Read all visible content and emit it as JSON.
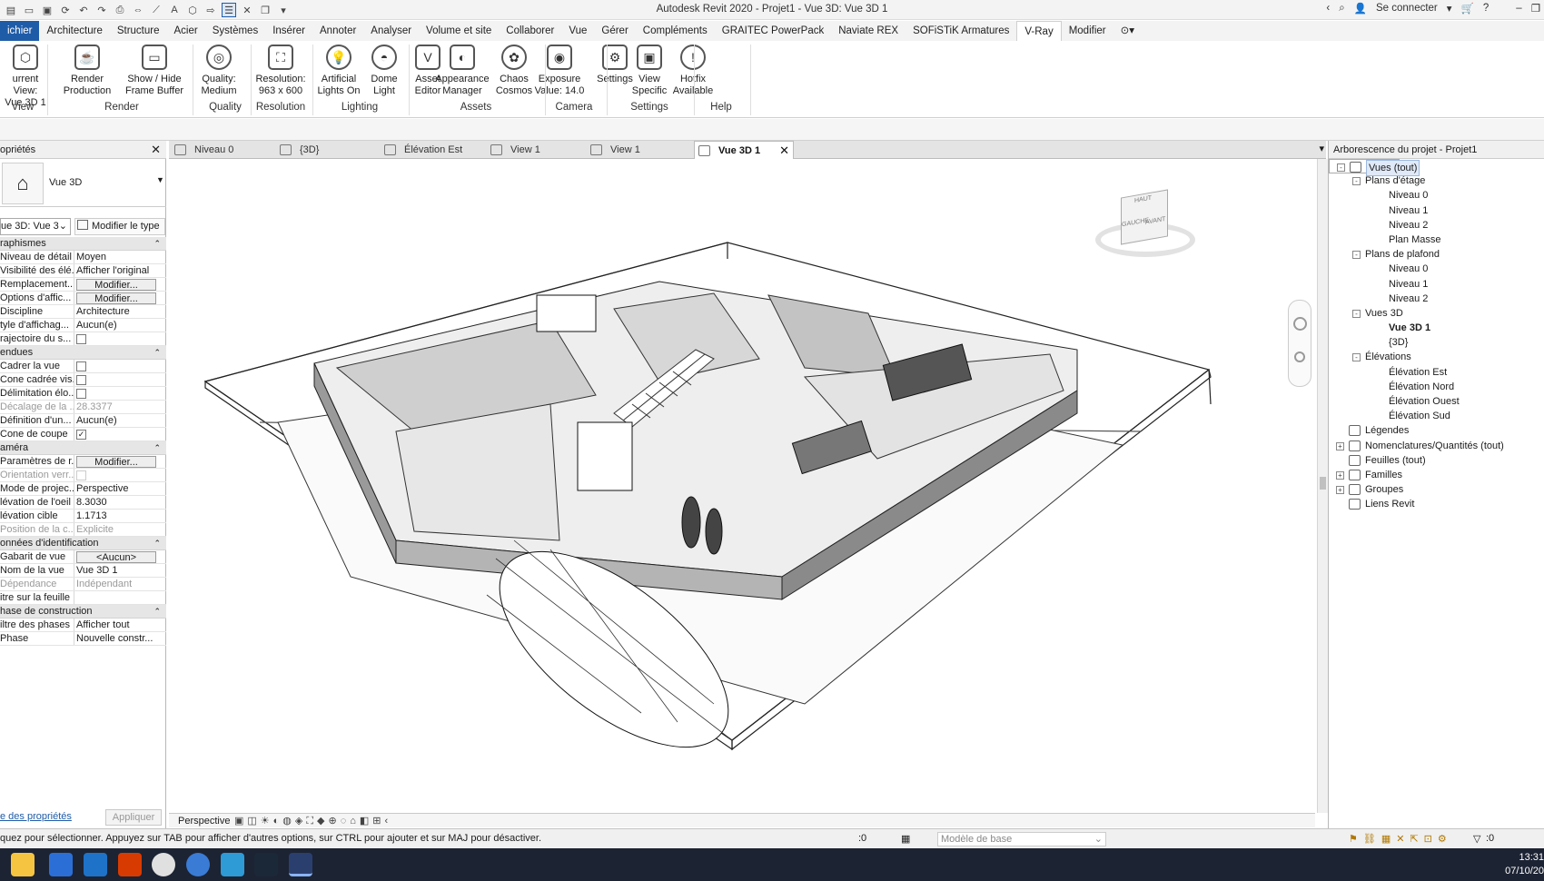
{
  "window": {
    "title": "Autodesk Revit 2020 - Projet1 - Vue 3D: Vue 3D 1",
    "sign_in": "Se connecter"
  },
  "ribbon_tabs": [
    "ichier",
    "Architecture",
    "Structure",
    "Acier",
    "Systèmes",
    "Insérer",
    "Annoter",
    "Analyser",
    "Volume et site",
    "Collaborer",
    "Vue",
    "Gérer",
    "Compléments",
    "GRAITEC PowerPack",
    "Naviate REX",
    "SOFiSTiK Armatures",
    "V-Ray",
    "Modifier"
  ],
  "active_tab": "V-Ray",
  "ribbon": {
    "buttons": [
      {
        "label1": "urrent View:",
        "label2": "Vue 3D 1",
        "icon": "cube-icon"
      },
      {
        "label1": "Render",
        "label2": "Production",
        "icon": "teapot-icon"
      },
      {
        "label1": "Show / Hide",
        "label2": "Frame Buffer",
        "icon": "frame-buffer-icon"
      },
      {
        "label1": "Quality:",
        "label2": "Medium",
        "icon": "quality-icon"
      },
      {
        "label1": "Resolution:",
        "label2": "963 x 600",
        "icon": "resolution-icon"
      },
      {
        "label1": "Artificial",
        "label2": "Lights On",
        "icon": "bulb-icon"
      },
      {
        "label1": "Dome",
        "label2": "Light",
        "icon": "dome-icon"
      },
      {
        "label1": "Asset",
        "label2": "Editor",
        "icon": "vray-icon"
      },
      {
        "label1": "Appearance",
        "label2": "Manager",
        "icon": "appearance-icon"
      },
      {
        "label1": "Chaos",
        "label2": "Cosmos",
        "icon": "cosmos-icon"
      },
      {
        "label1": "Exposure",
        "label2": "Value: 14.0",
        "icon": "camera-icon"
      },
      {
        "label1": "Settings",
        "label2": "",
        "icon": "gear-icon"
      },
      {
        "label1": "View",
        "label2": "Specific",
        "icon": "view-specific-icon"
      },
      {
        "label1": "Hotfix",
        "label2": "Available",
        "icon": "alert-icon"
      }
    ],
    "groups": [
      "View",
      "Render",
      "Quality",
      "Resolution",
      "Lighting",
      "Assets",
      "Camera",
      "Settings",
      "Help"
    ]
  },
  "properties": {
    "header": "opriétés",
    "type_name": "Vue 3D",
    "instance_select": "ue 3D: Vue 3",
    "edit_type": "Modifier le type",
    "categories": [
      {
        "name": "raphismes",
        "rows": [
          {
            "k": "Niveau de détail",
            "v": "Moyen",
            "kind": "text"
          },
          {
            "k": "Visibilité des élé...",
            "v": "Afficher l'original",
            "kind": "text"
          },
          {
            "k": "Remplacement...",
            "v": "Modifier...",
            "kind": "button"
          },
          {
            "k": "Options d'affic...",
            "v": "Modifier...",
            "kind": "button"
          },
          {
            "k": "Discipline",
            "v": "Architecture",
            "kind": "text"
          },
          {
            "k": "tyle d'affichag...",
            "v": "Aucun(e)",
            "kind": "text"
          },
          {
            "k": "rajectoire du s...",
            "v": "",
            "kind": "check"
          }
        ]
      },
      {
        "name": "endues",
        "rows": [
          {
            "k": "Cadrer la vue",
            "v": "",
            "kind": "check"
          },
          {
            "k": "Cone cadrée vis...",
            "v": "",
            "kind": "check"
          },
          {
            "k": "Délimitation élo...",
            "v": "",
            "kind": "check"
          },
          {
            "k": "Décalage de la ...",
            "v": "28.3377",
            "kind": "dim"
          },
          {
            "k": "Définition d'un...",
            "v": "Aucun(e)",
            "kind": "text"
          },
          {
            "k": "Cone de coupe",
            "v": "✓",
            "kind": "checked"
          }
        ]
      },
      {
        "name": "améra",
        "rows": [
          {
            "k": "Paramètres de r...",
            "v": "Modifier...",
            "kind": "button"
          },
          {
            "k": "Orientation verr...",
            "v": "",
            "kind": "dimcheck"
          },
          {
            "k": "Mode de projec...",
            "v": "Perspective",
            "kind": "text"
          },
          {
            "k": "lévation de l'oeil",
            "v": "8.3030",
            "kind": "text"
          },
          {
            "k": "lévation cible",
            "v": "1.1713",
            "kind": "text"
          },
          {
            "k": "Position de la c...",
            "v": "Explicite",
            "kind": "dim"
          }
        ]
      },
      {
        "name": "onnées d'identification",
        "rows": [
          {
            "k": "Gabarit de vue",
            "v": "<Aucun>",
            "kind": "button"
          },
          {
            "k": "Nom de la vue",
            "v": "Vue 3D 1",
            "kind": "text"
          },
          {
            "k": "Dépendance",
            "v": "Indépendant",
            "kind": "dim"
          },
          {
            "k": "itre sur la feuille",
            "v": "",
            "kind": "text"
          }
        ]
      },
      {
        "name": "hase de construction",
        "rows": [
          {
            "k": "iltre des phases",
            "v": "Afficher tout",
            "kind": "text"
          },
          {
            "k": "Phase",
            "v": "Nouvelle constr...",
            "kind": "text"
          }
        ]
      }
    ],
    "help_link": "e des propriétés",
    "apply": "Appliquer"
  },
  "view_tabs": [
    {
      "label": "Niveau 0",
      "active": false
    },
    {
      "label": "{3D}",
      "active": false
    },
    {
      "label": "Élévation Est",
      "active": false
    },
    {
      "label": "View 1",
      "active": false
    },
    {
      "label": "View 1",
      "active": false
    },
    {
      "label": "Vue 3D 1",
      "active": true
    }
  ],
  "viewcube": {
    "top": "HAUT",
    "left": "GAUCHE",
    "front": "AVANT"
  },
  "view_control": {
    "mode": "Perspective"
  },
  "browser": {
    "header": "Arborescence du projet - Projet1",
    "nodes": [
      {
        "label": "Vues (tout)",
        "depth": 0,
        "toggle": "-",
        "sel": true
      },
      {
        "label": "Plans d'étage",
        "depth": 1,
        "toggle": "-"
      },
      {
        "label": "Niveau 0",
        "depth": 2
      },
      {
        "label": "Niveau 1",
        "depth": 2
      },
      {
        "label": "Niveau 2",
        "depth": 2
      },
      {
        "label": "Plan Masse",
        "depth": 2
      },
      {
        "label": "Plans de plafond",
        "depth": 1,
        "toggle": "-"
      },
      {
        "label": "Niveau 0",
        "depth": 2
      },
      {
        "label": "Niveau 1",
        "depth": 2
      },
      {
        "label": "Niveau 2",
        "depth": 2
      },
      {
        "label": "Vues 3D",
        "depth": 1,
        "toggle": "-"
      },
      {
        "label": "Vue 3D 1",
        "depth": 2,
        "bold": true
      },
      {
        "label": "{3D}",
        "depth": 2
      },
      {
        "label": "Élévations",
        "depth": 1,
        "toggle": "-"
      },
      {
        "label": "Élévation Est",
        "depth": 2
      },
      {
        "label": "Élévation Nord",
        "depth": 2
      },
      {
        "label": "Élévation Ouest",
        "depth": 2
      },
      {
        "label": "Élévation Sud",
        "depth": 2
      },
      {
        "label": "Légendes",
        "depth": 0,
        "icon": true
      },
      {
        "label": "Nomenclatures/Quantités (tout)",
        "depth": 0,
        "toggle": "+",
        "icon": true
      },
      {
        "label": "Feuilles (tout)",
        "depth": 0,
        "icon": true
      },
      {
        "label": "Familles",
        "depth": 0,
        "toggle": "+",
        "icon": true
      },
      {
        "label": "Groupes",
        "depth": 0,
        "toggle": "+",
        "icon": true
      },
      {
        "label": "Liens Revit",
        "depth": 0,
        "icon": true
      }
    ]
  },
  "status": {
    "message": "quez pour sélectionner. Appuyez sur TAB pour afficher d'autres options, sur CTRL pour ajouter et sur MAJ pour désactiver.",
    "worksets": ":0",
    "model": "Modèle de base",
    "filter_count": ":0"
  },
  "taskbar": {
    "time": "13:31",
    "date": "07/10/20"
  },
  "colors": {
    "file_tab": "#1f5ca8",
    "taskbar": "#1c2333",
    "selection": "#dfe9f7"
  }
}
